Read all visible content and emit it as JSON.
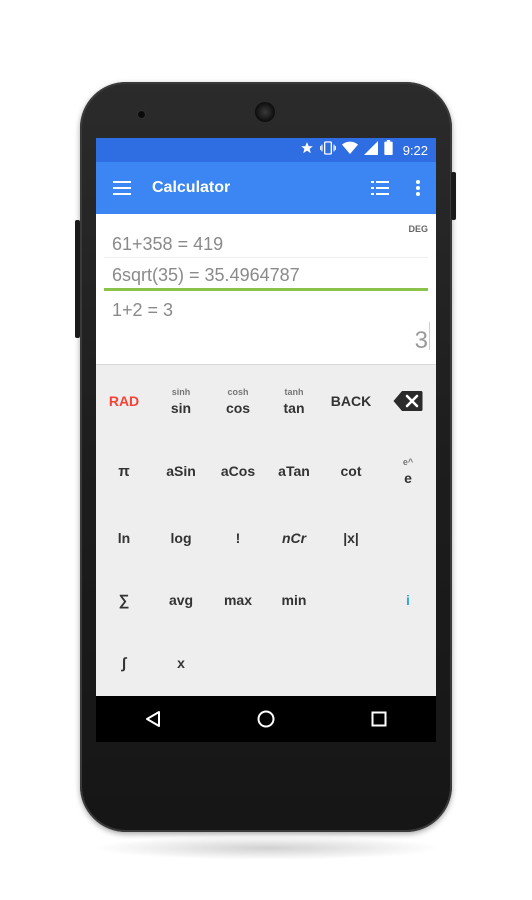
{
  "status_bar": {
    "time": "9:22",
    "icons": [
      "star-icon",
      "vibrate-icon",
      "wifi-icon",
      "signal-icon",
      "battery-icon"
    ]
  },
  "app_bar": {
    "title": "Calculator",
    "menu_icon": "hamburger-menu-icon",
    "list_icon": "history-list-icon",
    "more_icon": "more-vert-icon"
  },
  "display": {
    "angle_mode": "DEG",
    "history": [
      "61+358 = 419",
      "6sqrt(35) = 35.4964787",
      "1+2 = 3"
    ],
    "current_result": "3"
  },
  "keypad": {
    "rows": [
      [
        {
          "label": "RAD",
          "sup": ""
        },
        {
          "label": "sin",
          "sup": "sinh"
        },
        {
          "label": "cos",
          "sup": "cosh"
        },
        {
          "label": "tan",
          "sup": "tanh"
        },
        {
          "label": "BACK",
          "sup": ""
        },
        {
          "label": "",
          "sup": "",
          "icon": "backspace-icon"
        }
      ],
      [
        {
          "label": "π",
          "sup": ""
        },
        {
          "label": "aSin",
          "sup": ""
        },
        {
          "label": "aCos",
          "sup": ""
        },
        {
          "label": "aTan",
          "sup": ""
        },
        {
          "label": "cot",
          "sup": ""
        },
        {
          "label": "e",
          "sup": "e^"
        }
      ],
      [
        {
          "label": "ln",
          "sup": ""
        },
        {
          "label": "log",
          "sup": ""
        },
        {
          "label": "!",
          "sup": ""
        },
        {
          "label": "nCr",
          "sup": ""
        },
        {
          "label": "|x|",
          "sup": ""
        },
        {
          "label": "",
          "sup": ""
        }
      ],
      [
        {
          "label": "∑",
          "sup": ""
        },
        {
          "label": "avg",
          "sup": ""
        },
        {
          "label": "max",
          "sup": ""
        },
        {
          "label": "min",
          "sup": ""
        },
        {
          "label": "",
          "sup": ""
        },
        {
          "label": "i",
          "sup": ""
        }
      ],
      [
        {
          "label": "∫",
          "sup": ""
        },
        {
          "label": "x",
          "sup": ""
        }
      ]
    ]
  },
  "nav_bar": {
    "back_icon": "back-triangle-icon",
    "home_icon": "home-circle-icon",
    "recents_icon": "recents-square-icon"
  },
  "colors": {
    "status_bar": "#2f6de2",
    "app_bar": "#3c86f4",
    "accent_line": "#8bc34a",
    "rad_text": "#f44336",
    "info_text": "#29a8e0",
    "keypad_bg": "#eeeeee"
  }
}
